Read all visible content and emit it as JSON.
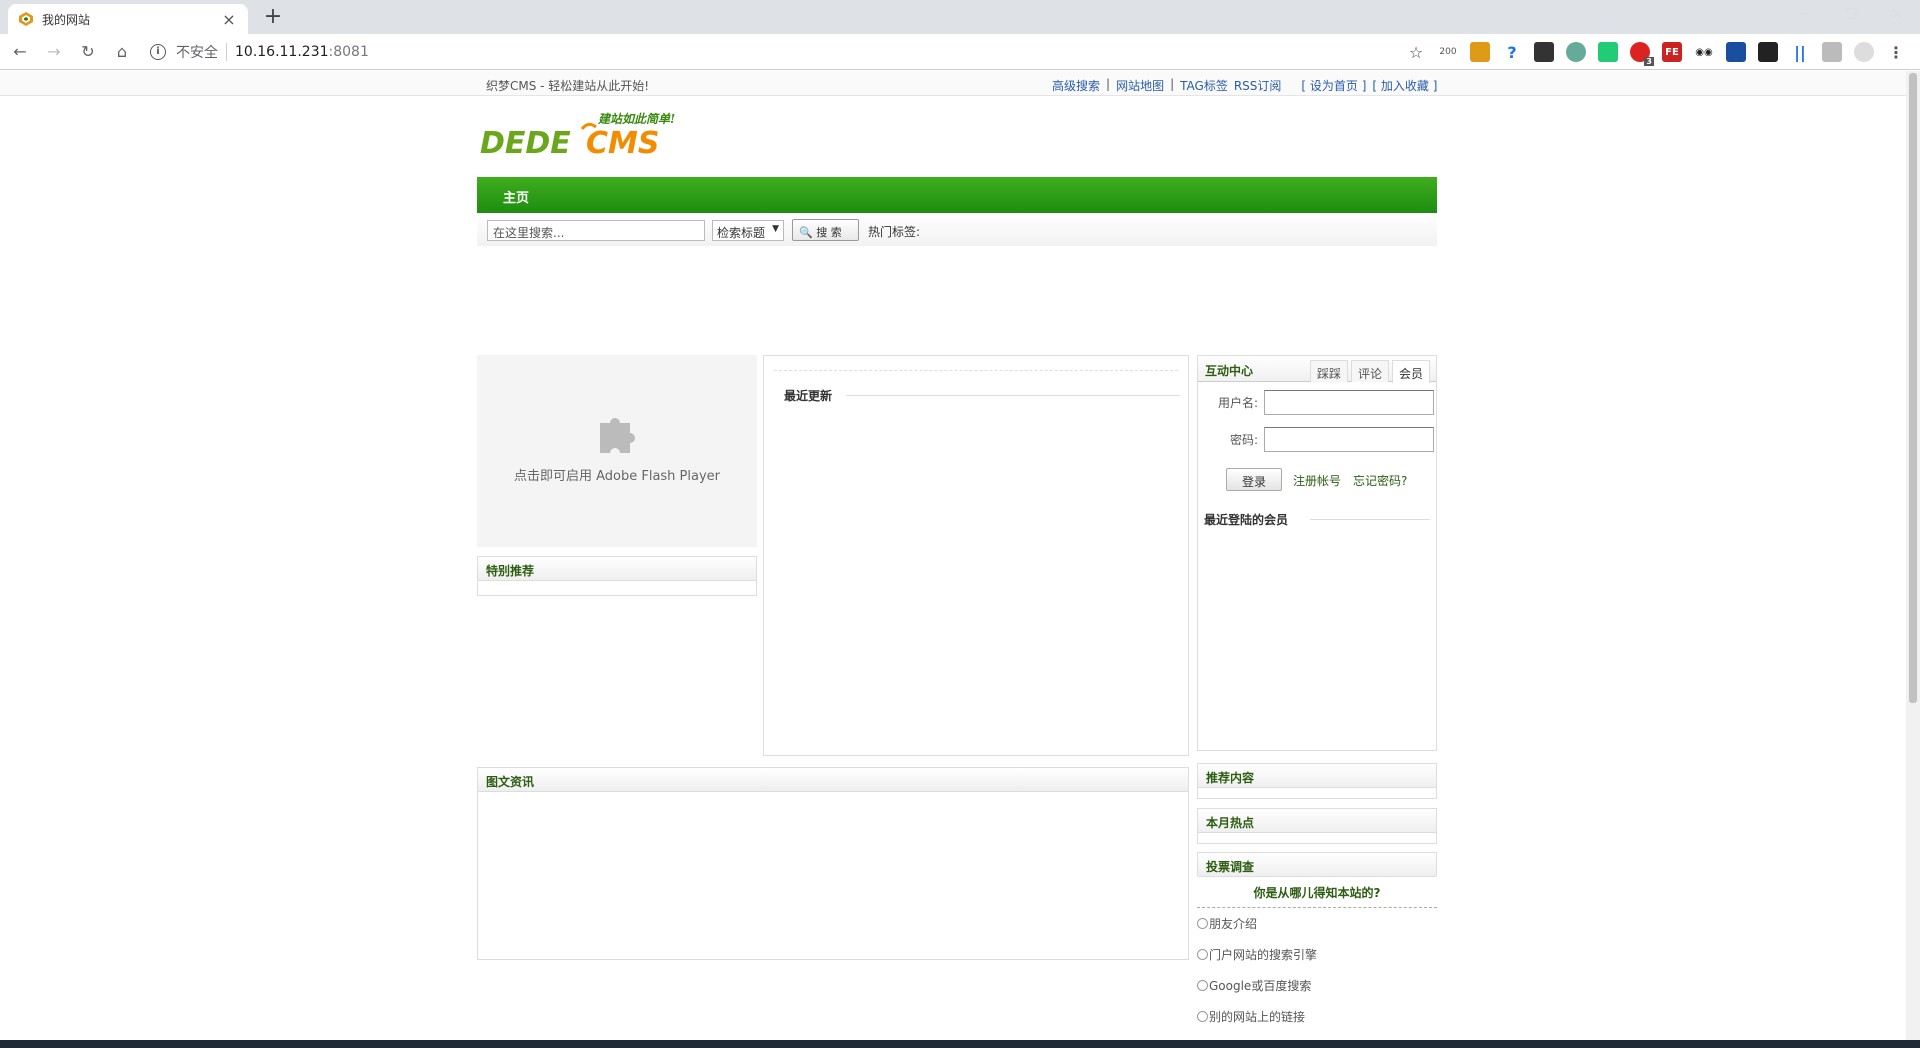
{
  "browser": {
    "tab_title": "我的网站",
    "new_tab_symbol": "+",
    "security_label": "不安全",
    "url_host": "10.16.11.231",
    "url_port": ":8081",
    "ext_badge_200": "200",
    "ext_badge_3": "3"
  },
  "topbar": {
    "slogan": "织梦CMS - 轻松建站从此开始!",
    "links": [
      "高级搜索",
      "网站地图",
      "TAG标签",
      "RSS订阅"
    ],
    "sep": "|",
    "set_home": "[ 设为首页 ]",
    "bookmark": "[ 加入收藏 ]"
  },
  "logo": {
    "main": "DEDECMS",
    "tagline": "建站如此简单!"
  },
  "nav": {
    "home": "主页"
  },
  "search": {
    "placeholder": "在这里搜索...",
    "select_value": "检索标题",
    "button": "搜 索",
    "hot_tags": "热门标签:"
  },
  "flash": {
    "message": "点击即可启用 Adobe Flash Player"
  },
  "left": {
    "special": "特别推荐"
  },
  "middle": {
    "recent_updates": "最近更新"
  },
  "pictures": {
    "title": "图文资讯"
  },
  "interact": {
    "title": "互动中心",
    "tabs": [
      "踩踩",
      "评论",
      "会员"
    ],
    "username_label": "用户名:",
    "password_label": "密码:",
    "login_button": "登录",
    "register_link": "注册帐号",
    "forgot_link": "忘记密码?",
    "recent_members": "最近登陆的会员"
  },
  "right": {
    "recommended": "推荐内容",
    "monthly_hot": "本月热点",
    "poll": "投票调查"
  },
  "poll": {
    "question": "你是从哪儿得知本站的?",
    "options": [
      "朋友介绍",
      "门户网站的搜索引擎",
      "Google或百度搜索",
      "别的网站上的链接"
    ]
  },
  "colors": {
    "nav_green": "#1e8c10",
    "title_green": "#2d5d12",
    "logo_green": "#6aa71a",
    "logo_orange": "#f28c00"
  }
}
